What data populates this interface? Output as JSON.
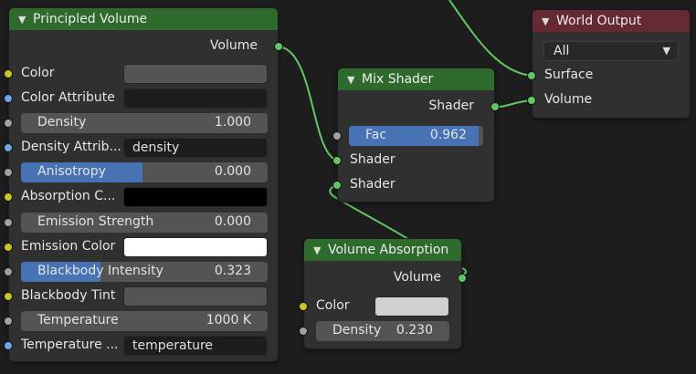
{
  "colors": {
    "shader_header": "#2d6a2b",
    "output_header": "#652931",
    "link": "#62c662",
    "socket_color": "#c7c729",
    "socket_vector": "#6ca6e8",
    "socket_float": "#a1a1a1",
    "socket_shader": "#62c662",
    "slider_fill": "#4772b3"
  },
  "principled": {
    "title": "Principled Volume",
    "output_label": "Volume",
    "color_label": "Color",
    "color_swatch": "#545454",
    "color_attr_label": "Color Attribute",
    "color_attr_value": "",
    "density_label": "Density",
    "density_value": "1.000",
    "density_attr_label": "Density Attrib...",
    "density_attr_value": "density",
    "anisotropy_label": "Anisotropy",
    "anisotropy_value": "0.000",
    "absorption_label": "Absorption C...",
    "absorption_swatch": "#000000",
    "emission_strength_label": "Emission Strength",
    "emission_strength_value": "0.000",
    "emission_color_label": "Emission Color",
    "emission_swatch": "#ffffff",
    "blackbody_intensity_label": "Blackbody Intensity",
    "blackbody_intensity_value": "0.323",
    "blackbody_tint_label": "Blackbody Tint",
    "blackbody_tint_swatch": "#545454",
    "temperature_label": "Temperature",
    "temperature_value": "1000 K",
    "temperature_attr_label": "Temperature ...",
    "temperature_attr_value": "temperature"
  },
  "mix": {
    "title": "Mix Shader",
    "output_label": "Shader",
    "fac_label": "Fac",
    "fac_value": "0.962",
    "shader1_label": "Shader",
    "shader2_label": "Shader"
  },
  "absorption": {
    "title": "Volume Absorption",
    "output_label": "Volume",
    "color_label": "Color",
    "color_swatch": "#d0d0d0",
    "density_label": "Density",
    "density_value": "0.230"
  },
  "world": {
    "title": "World Output",
    "target_value": "All",
    "surface_label": "Surface",
    "volume_label": "Volume"
  }
}
